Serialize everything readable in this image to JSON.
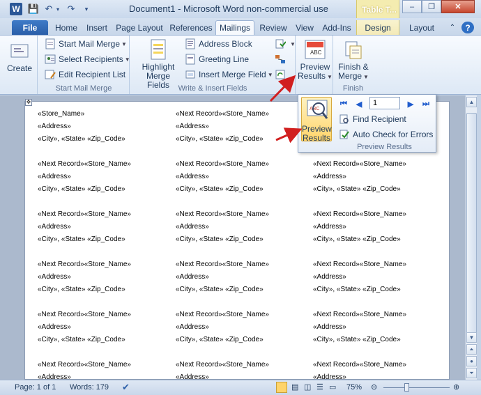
{
  "window": {
    "title": "Document1  -  Microsoft Word non-commercial use",
    "contextual_group": "Table T...",
    "controls": {
      "minimize": "–",
      "restore": "❐",
      "close": "✕"
    }
  },
  "tabs": [
    {
      "label": "File"
    },
    {
      "label": "Home"
    },
    {
      "label": "Insert"
    },
    {
      "label": "Page Layout"
    },
    {
      "label": "References"
    },
    {
      "label": "Mailings"
    },
    {
      "label": "Review"
    },
    {
      "label": "View"
    },
    {
      "label": "Add-Ins"
    },
    {
      "label": "Design"
    },
    {
      "label": "Layout"
    }
  ],
  "ribbon": {
    "create": {
      "label": "Create"
    },
    "start_mail_merge": {
      "group_label": "Start Mail Merge",
      "start": "Start Mail Merge",
      "select": "Select Recipients",
      "edit": "Edit Recipient List"
    },
    "write_insert": {
      "group_label": "Write & Insert Fields",
      "highlight_line1": "Highlight",
      "highlight_line2": "Merge Fields",
      "address_block": "Address Block",
      "greeting_line": "Greeting Line",
      "insert_merge_field": "Insert Merge Field"
    },
    "preview": {
      "line1": "Preview",
      "line2": "Results",
      "icon_text": "ABC"
    },
    "finish": {
      "group_label": "Finish",
      "line1": "Finish &",
      "line2": "Merge"
    }
  },
  "popup": {
    "preview_line1": "Preview",
    "preview_line2": "Results",
    "record": "1",
    "find_recipient": "Find Recipient",
    "auto_check": "Auto Check for Errors",
    "group_label": "Preview Results"
  },
  "document": {
    "first_name_line": "«Store_Name»",
    "name_line": "«Next Record»«Store_Name»",
    "address_line": "«Address»",
    "city_line": "«City», «State» «Zip_Code»"
  },
  "statusbar": {
    "page": "Page: 1 of 1",
    "words": "Words: 179",
    "zoom": "75%"
  },
  "colors": {
    "accent": "#2b5797",
    "highlight": "#ffd46a",
    "arrow": "#d11f1f"
  }
}
